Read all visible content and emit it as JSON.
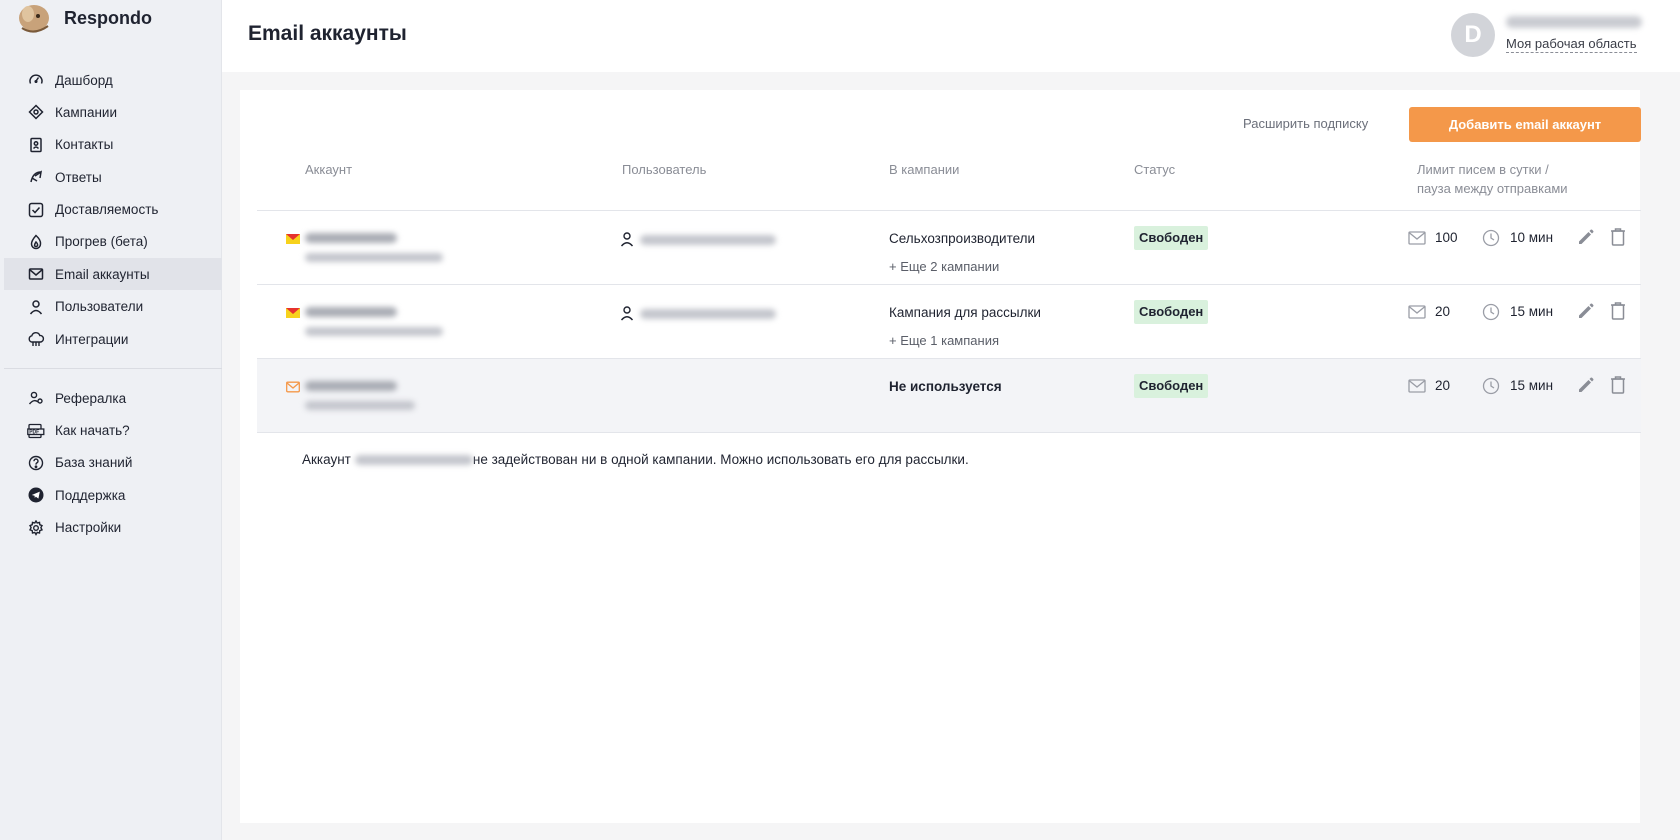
{
  "app": {
    "name": "Respondo"
  },
  "sidebar": {
    "items": [
      {
        "label": "Дашборд",
        "icon": "dashboard-icon"
      },
      {
        "label": "Кампании",
        "icon": "campaigns-icon"
      },
      {
        "label": "Контакты",
        "icon": "contacts-icon"
      },
      {
        "label": "Ответы",
        "icon": "replies-icon"
      },
      {
        "label": "Доставляемость",
        "icon": "deliverability-icon"
      },
      {
        "label": "Прогрев (бета)",
        "icon": "warmup-flame-icon"
      },
      {
        "label": "Email аккаунты",
        "icon": "mail-icon",
        "active": true
      },
      {
        "label": "Пользователи",
        "icon": "user-icon"
      },
      {
        "label": "Интеграции",
        "icon": "cloud-icon"
      }
    ],
    "secondary": [
      {
        "label": "Рефералка",
        "icon": "referral-icon"
      },
      {
        "label": "Как начать?",
        "icon": "pdf-icon"
      },
      {
        "label": "База знаний",
        "icon": "help-icon"
      },
      {
        "label": "Поддержка",
        "icon": "telegram-icon"
      },
      {
        "label": "Настройки",
        "icon": "gear-icon"
      }
    ]
  },
  "header": {
    "title": "Email аккаунты",
    "avatar_letter": "D",
    "workspace": "Моя рабочая область"
  },
  "toolbar": {
    "extend_label": "Расширить подписку",
    "add_label": "Добавить email аккаунт"
  },
  "table": {
    "columns": {
      "account": "Аккаунт",
      "user": "Пользователь",
      "campaign": "В кампании",
      "status": "Статус",
      "limit_line1": "Лимит писем в сутки /",
      "limit_line2": "пауза между отправками"
    },
    "rows": [
      {
        "campaign": "Сельхозпроизводители",
        "more": "+ Еще 2 кампании",
        "status": "Свободен",
        "limit": "100",
        "pause": "10 мин",
        "provider": "yandex"
      },
      {
        "campaign": "Кампания для рассылки",
        "more": "+ Еще 1 кампания",
        "status": "Свободен",
        "limit": "20",
        "pause": "15 мин",
        "provider": "yandex"
      },
      {
        "campaign": "Не используется",
        "more": "",
        "status": "Свободен",
        "limit": "20",
        "pause": "15 мин",
        "provider": "generic"
      }
    ]
  },
  "notice": {
    "prefix": "Аккаунт",
    "suffix": "не задействован ни в одной кампании. Можно использовать его для рассылки."
  },
  "colors": {
    "accent": "#f4984a",
    "status_free_bg": "#d9f1dd",
    "sidebar_bg": "#eef0f4",
    "active_item_bg": "#e1e3e9"
  }
}
